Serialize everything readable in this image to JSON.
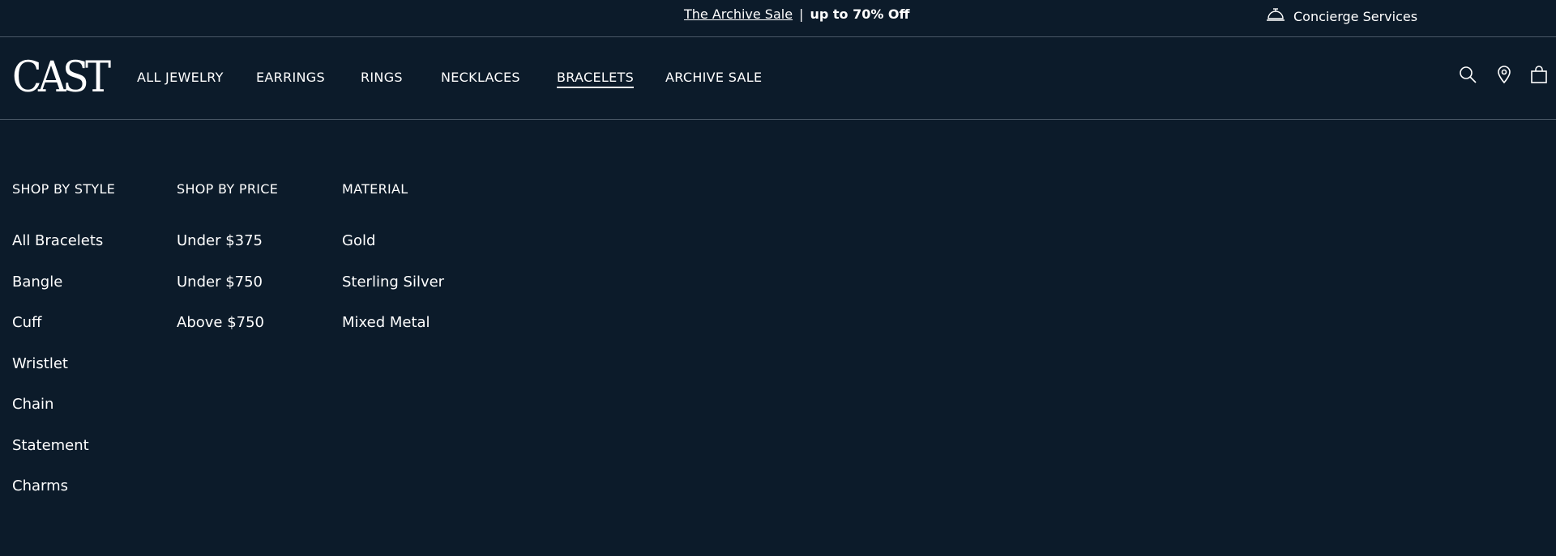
{
  "announcement": {
    "link": "The Archive Sale",
    "separator": "|",
    "offer": "up to 70% Off",
    "concierge": "Concierge Services"
  },
  "brand": {
    "logo": "CAST"
  },
  "nav": {
    "items": [
      {
        "label": "ALL JEWELRY"
      },
      {
        "label": "EARRINGS"
      },
      {
        "label": "RINGS"
      },
      {
        "label": "NECKLACES"
      },
      {
        "label": "BRACELETS",
        "active": true
      },
      {
        "label": "ARCHIVE SALE"
      }
    ],
    "icons": [
      "search-icon",
      "location-icon",
      "bag-icon"
    ]
  },
  "menu": {
    "columns": [
      {
        "heading": "SHOP BY STYLE",
        "items": [
          "All Bracelets",
          "Bangle",
          "Cuff",
          "Wristlet",
          "Chain",
          "Statement",
          "Charms"
        ]
      },
      {
        "heading": "SHOP BY PRICE",
        "items": [
          "Under $375",
          "Under $750",
          "Above $750"
        ]
      },
      {
        "heading": "MATERIAL",
        "items": [
          "Gold",
          "Sterling Silver",
          "Mixed Metal"
        ]
      }
    ]
  },
  "colors": {
    "background": "#0c1b2a",
    "text": "#ffffff",
    "divider": "#4a5866"
  }
}
